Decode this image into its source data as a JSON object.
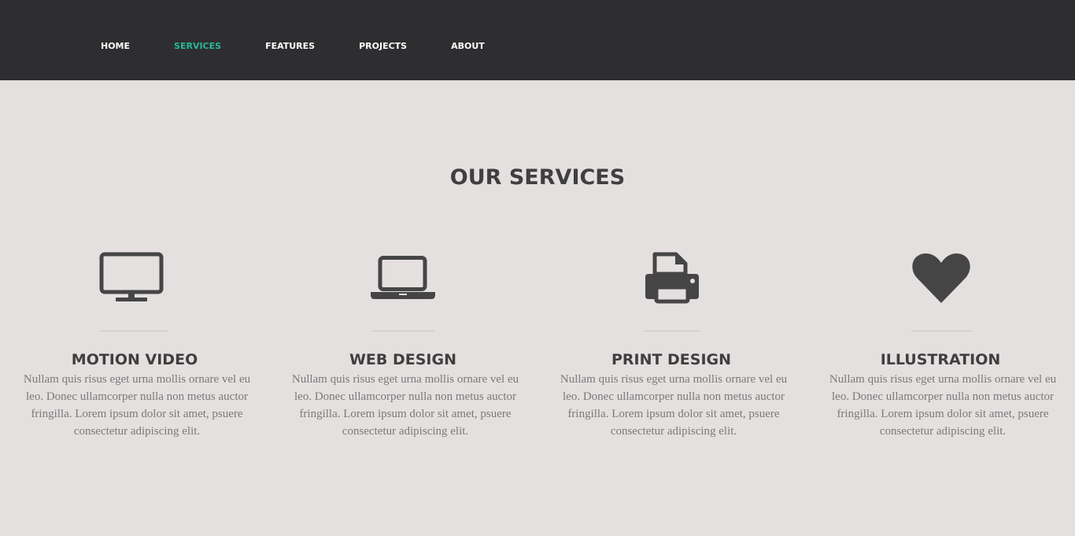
{
  "nav": {
    "items": [
      {
        "label": "HOME",
        "active": false
      },
      {
        "label": "SERVICES",
        "active": true
      },
      {
        "label": "FEATURES",
        "active": false
      },
      {
        "label": "PROJECTS",
        "active": false
      },
      {
        "label": "ABOUT",
        "active": false
      }
    ],
    "accent_color": "#28b898"
  },
  "services": {
    "title": "OUR SERVICES",
    "items": [
      {
        "icon": "monitor-icon",
        "title": "MOTION VIDEO",
        "text": "Nullam quis risus eget urna mollis ornare vel eu leo. Donec ullamcorper nulla non metus auctor fringilla. Lorem ipsum dolor sit amet, psuere consectetur adipiscing elit."
      },
      {
        "icon": "laptop-icon",
        "title": "WEB DESIGN",
        "text": "Nullam quis risus eget urna mollis ornare vel eu leo. Donec ullamcorper nulla non metus auctor fringilla. Lorem ipsum dolor sit amet, psuere consectetur adipiscing elit."
      },
      {
        "icon": "printer-icon",
        "title": "PRINT DESIGN",
        "text": "Nullam quis risus eget urna mollis ornare vel eu leo. Donec ullamcorper nulla non metus auctor fringilla. Lorem ipsum dolor sit amet, psuere consectetur adipiscing elit."
      },
      {
        "icon": "heart-icon",
        "title": "ILLUSTRATION",
        "text": "Nullam quis risus eget urna mollis ornare vel eu leo. Donec ullamcorper nulla non metus auctor fringilla. Lorem ipsum dolor sit amet, psuere consectetur adipiscing elit."
      }
    ]
  }
}
